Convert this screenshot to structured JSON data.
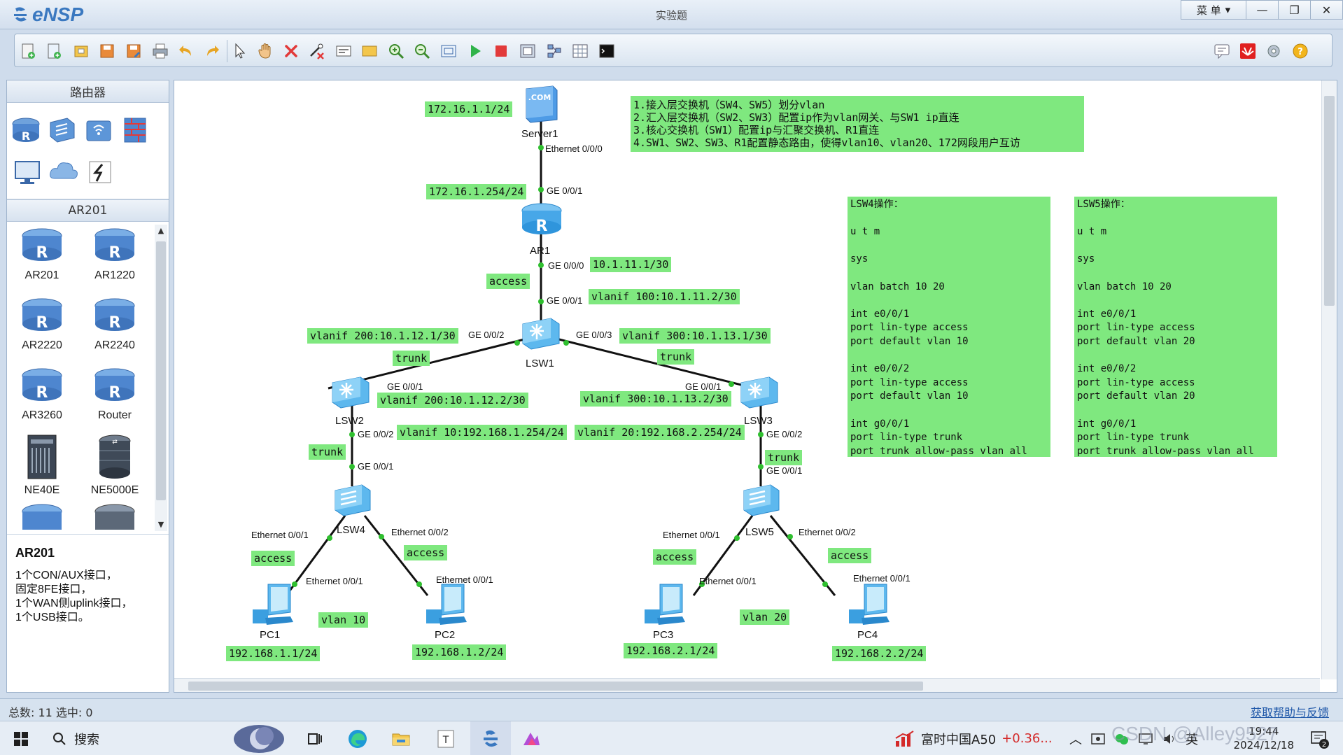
{
  "app": {
    "name": "eNSP",
    "window_title": "实验题"
  },
  "window_controls": {
    "menu_label": "菜 单",
    "minimize": "—",
    "restore": "❐",
    "close": "✕"
  },
  "toolbar": {
    "buttons": [
      "new-topology-icon",
      "new-lab-icon",
      "open-icon",
      "save-icon",
      "save-as-icon",
      "print-icon",
      "undo-icon",
      "redo-icon",
      "select-icon",
      "hand-icon",
      "delete-icon",
      "delete-link-icon",
      "text-icon",
      "rectangle-icon",
      "zoom-in-icon",
      "zoom-out-icon",
      "fit-icon",
      "start-icon",
      "stop-icon",
      "capture-icon",
      "topology-icon",
      "grid-icon",
      "terminal-icon"
    ],
    "right_buttons": [
      "chat-icon",
      "huawei-icon",
      "settings-icon",
      "help-icon"
    ]
  },
  "left_panel": {
    "category_header": "路由器",
    "category_icons": [
      "router-category-icon",
      "switch-category-icon",
      "wireless-category-icon",
      "firewall-category-icon",
      "terminal-category-icon",
      "cloud-category-icon",
      "link-category-icon"
    ],
    "device_header": "AR201",
    "devices": [
      "AR201",
      "AR1220",
      "AR2220",
      "AR2240",
      "AR3260",
      "Router",
      "NE40E",
      "NE5000E"
    ],
    "description": {
      "title": "AR201",
      "lines": [
        "1个CON/AUX接口，",
        "固定8FE接口，",
        "1个WAN侧uplink接口，",
        "1个USB接口。"
      ]
    }
  },
  "topology": {
    "devices": {
      "server1": "Server1",
      "ar1": "AR1",
      "lsw1": "LSW1",
      "lsw2": "LSW2",
      "lsw3": "LSW3",
      "lsw4": "LSW4",
      "lsw5": "LSW5",
      "pc1": "PC1",
      "pc2": "PC2",
      "pc3": "PC3",
      "pc4": "PC4"
    },
    "server_badge": ".COM",
    "ports": {
      "server1_eth": "Ethernet 0/0/0",
      "ar1_ge001": "GE 0/0/1",
      "ar1_ge000": "GE 0/0/0",
      "lsw1_ge001": "GE 0/0/1",
      "lsw1_ge002": "GE 0/0/2",
      "lsw1_ge003": "GE 0/0/3",
      "lsw2_ge001": "GE 0/0/1",
      "lsw2_ge002": "GE 0/0/2",
      "lsw3_ge001": "GE 0/0/1",
      "lsw3_ge002": "GE 0/0/2",
      "lsw4_ge001": "GE 0/0/1",
      "lsw5_ge001": "GE 0/0/1",
      "lsw4_e001": "Ethernet 0/0/1",
      "lsw4_e002": "Ethernet 0/0/2",
      "pc1_e001": "Ethernet 0/0/1",
      "pc2_e001": "Ethernet 0/0/1",
      "lsw5_e001": "Ethernet 0/0/1",
      "lsw5_e002": "Ethernet 0/0/2",
      "pc3_e001": "Ethernet 0/0/1",
      "pc4_e001": "Ethernet 0/0/1"
    },
    "labels": {
      "server_ip": "172.16.1.1/24",
      "ar1_gw": "172.16.1.254/24",
      "ar1_ge000_ip": "10.1.11.1/30",
      "access_ar1": "access",
      "lsw1_vlanif100": "vlanif 100:10.1.11.2/30",
      "lsw1_vlanif200": "vlanif 200:10.1.12.1/30",
      "lsw1_vlanif300": "vlanif 300:10.1.13.1/30",
      "trunk_left": "trunk",
      "trunk_right": "trunk",
      "lsw2_vlanif200": "vlanif 200:10.1.12.2/30",
      "lsw3_vlanif300": "vlanif 300:10.1.13.2/30",
      "lsw2_vlanif10": "vlanif 10:192.168.1.254/24",
      "lsw3_vlanif20": "vlanif 20:192.168.2.254/24",
      "trunk_lsw2": "trunk",
      "trunk_lsw3": "trunk",
      "access_pc1": "access",
      "access_pc2": "access",
      "access_pc3": "access",
      "access_pc4": "access",
      "vlan10": "vlan 10",
      "vlan20": "vlan 20",
      "pc1_ip": "192.168.1.1/24",
      "pc2_ip": "192.168.1.2/24",
      "pc3_ip": "192.168.2.1/24",
      "pc4_ip": "192.168.2.2/24"
    },
    "task_notes": [
      "1.接入层交换机（SW4、SW5）划分vlan",
      "2.汇入层交换机（SW2、SW3）配置ip作为vlan网关、与SW1 ip直连",
      "3.核心交换机（SW1）配置ip与汇聚交换机、R1直连",
      "4.SW1、SW2、SW3、R1配置静态路由，使得vlan10、vlan20、172网段用户互访"
    ],
    "lsw4_config": "LSW4操作：\n\nu t m\n\nsys\n\nvlan batch 10 20\n\nint e0/0/1\nport lin-type access\nport default vlan 10\n\nint e0/0/2\nport lin-type access\nport default vlan 10\n\nint g0/0/1\nport lin-type trunk\nport trunk allow-pass vlan all",
    "lsw5_config": "LSW5操作：\n\nu t m\n\nsys\n\nvlan batch 10 20\n\nint e0/0/1\nport lin-type access\nport default vlan 20\n\nint e0/0/2\nport lin-type access\nport default vlan 20\n\nint g0/0/1\nport lin-type trunk\nport trunk allow-pass vlan all"
  },
  "statusbar": {
    "count": "总数: 11 选中: 0",
    "help": "获取帮助与反馈"
  },
  "taskbar": {
    "search": "搜索",
    "stock": "富时中国A50",
    "stock_change": "+0.36...",
    "ime": "英",
    "time": "19:44",
    "date": "2024/12/18",
    "notifications": "2",
    "watermark": "CSDN @Alley9527"
  },
  "colors": {
    "label_green": "#7fe87f",
    "link": "#111111",
    "port_dot": "#2fbf2f"
  }
}
